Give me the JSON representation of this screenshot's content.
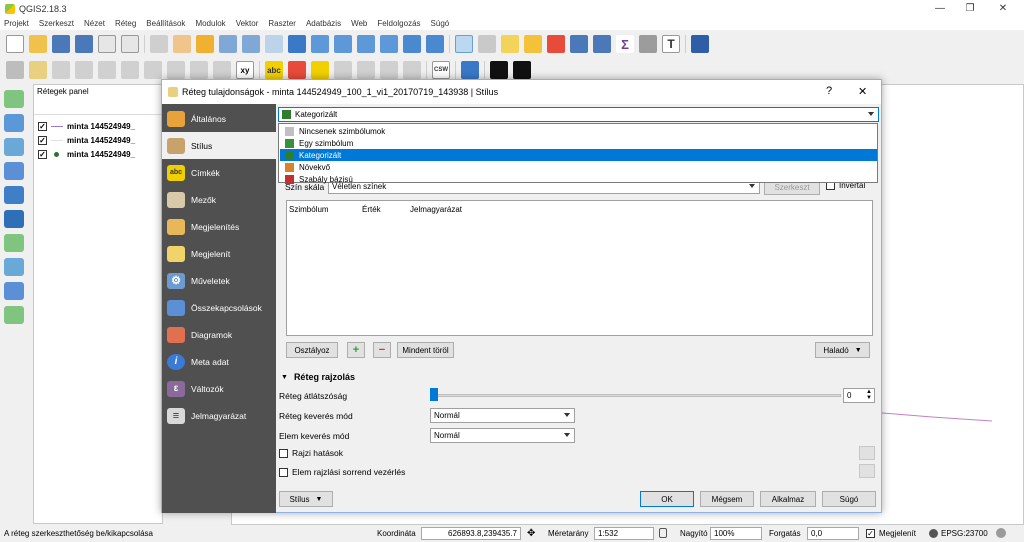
{
  "window": {
    "title": "QGIS2.18.3",
    "minimize": "—",
    "restore": "❐",
    "close": "✕"
  },
  "menu": [
    "Projekt",
    "Szerkeszt",
    "Nézet",
    "Réteg",
    "Beállítások",
    "Modulok",
    "Vektor",
    "Raszter",
    "Adatbázis",
    "Web",
    "Feldolgozás",
    "Súgó"
  ],
  "toolbar": {
    "csw_label": "CSW",
    "xy_label": "xy",
    "abc_label": "abc",
    "text_tool": "T"
  },
  "layers_panel": {
    "title": "Rétegek panel",
    "layers": [
      {
        "name": "minta 144524949_",
        "checked": true,
        "symbol": "line"
      },
      {
        "name": "minta 144524949_",
        "checked": true,
        "symbol": "line"
      },
      {
        "name": "minta 144524949_",
        "checked": true,
        "symbol": "point"
      }
    ]
  },
  "dialog": {
    "title": "Réteg tulajdonságok - minta 144524949_100_1_vi1_20170719_143938 | Stílus",
    "help": "?",
    "close": "✕",
    "nav": [
      {
        "label": "Általános",
        "icon": "wrench-icon",
        "color": "#e8a23a",
        "glyph": ""
      },
      {
        "label": "Stílus",
        "icon": "paint-icon",
        "color": "#c7a26b",
        "glyph": ""
      },
      {
        "label": "Címkék",
        "icon": "labels-icon",
        "color": "#f2d000",
        "glyph": "abc"
      },
      {
        "label": "Mezők",
        "icon": "fields-icon",
        "color": "#d9c9a8",
        "glyph": ""
      },
      {
        "label": "Megjelenítés",
        "icon": "brush-icon",
        "color": "#e8b75a",
        "glyph": ""
      },
      {
        "label": "Megjelenít",
        "icon": "tooltip-icon",
        "color": "#f0d46a",
        "glyph": ""
      },
      {
        "label": "Műveletek",
        "icon": "gear-icon",
        "color": "#6c9bd2",
        "glyph": "⚙"
      },
      {
        "label": "Összekapcsolások",
        "icon": "join-icon",
        "color": "#5b8fd6",
        "glyph": ""
      },
      {
        "label": "Diagramok",
        "icon": "diagram-icon",
        "color": "#e07050",
        "glyph": ""
      },
      {
        "label": "Meta adat",
        "icon": "info-icon",
        "color": "#3a7bd5",
        "glyph": "i"
      },
      {
        "label": "Változók",
        "icon": "variables-icon",
        "color": "#8a6a9a",
        "glyph": "ε"
      },
      {
        "label": "Jelmagyarázat",
        "icon": "legend-icon",
        "color": "#d9d9d9",
        "glyph": "≡"
      }
    ],
    "renderer_selected": "Kategorizált",
    "renderer_options": [
      {
        "label": "Nincsenek szimbólumok",
        "icon_color": "#c0c0c0"
      },
      {
        "label": "Egy szimbólum",
        "icon_color": "#3a8f3a"
      },
      {
        "label": "Kategorizált",
        "icon_color": "#2f7d2f"
      },
      {
        "label": "Növekvő",
        "icon_color": "#d9822b"
      },
      {
        "label": "Szabály bázisú",
        "icon_color": "#c23030"
      }
    ],
    "color_ramp_label": "Szín skála",
    "color_ramp_value": "Véletlen színek",
    "edit_button": "Szerkeszt",
    "invert_label": "Invertál",
    "table_headers": [
      "Szimbólum",
      "Érték",
      "Jelmagyarázat"
    ],
    "classify_button": "Osztályoz",
    "delete_all_button": "Mindent töröl",
    "advanced_button": "Haladó",
    "rendering_section": "Réteg rajzolás",
    "opacity_label": "Réteg átlátszóság",
    "opacity_value": "0",
    "layer_blend_label": "Réteg keverés mód",
    "layer_blend_value": "Normál",
    "feature_blend_label": "Elem keverés mód",
    "feature_blend_value": "Normál",
    "effects_label": "Rajzi hatások",
    "order_label": "Elem rajzlási sorrend vezérlés",
    "style_button": "Stílus",
    "ok_button": "OK",
    "cancel_button": "Mégsem",
    "apply_button": "Alkalmaz",
    "help_button": "Súgó"
  },
  "statusbar": {
    "message": "A réteg szerkeszthetőség be/kikapcsolása",
    "coord_label": "Koordináta",
    "coord_value": "626893.8,239435.7",
    "scale_label": "Méretarány",
    "scale_value": "1:532",
    "zoom_label": "Nagyító",
    "zoom_value": "100%",
    "rotation_label": "Forgatás",
    "rotation_value": "0,0",
    "render_label": "Megjelenít",
    "epsg": "EPSG:23700"
  },
  "colors": {
    "accent": "#0078d7",
    "dialog_nav_bg": "#505050",
    "canvas_line": "#c77fc0"
  }
}
